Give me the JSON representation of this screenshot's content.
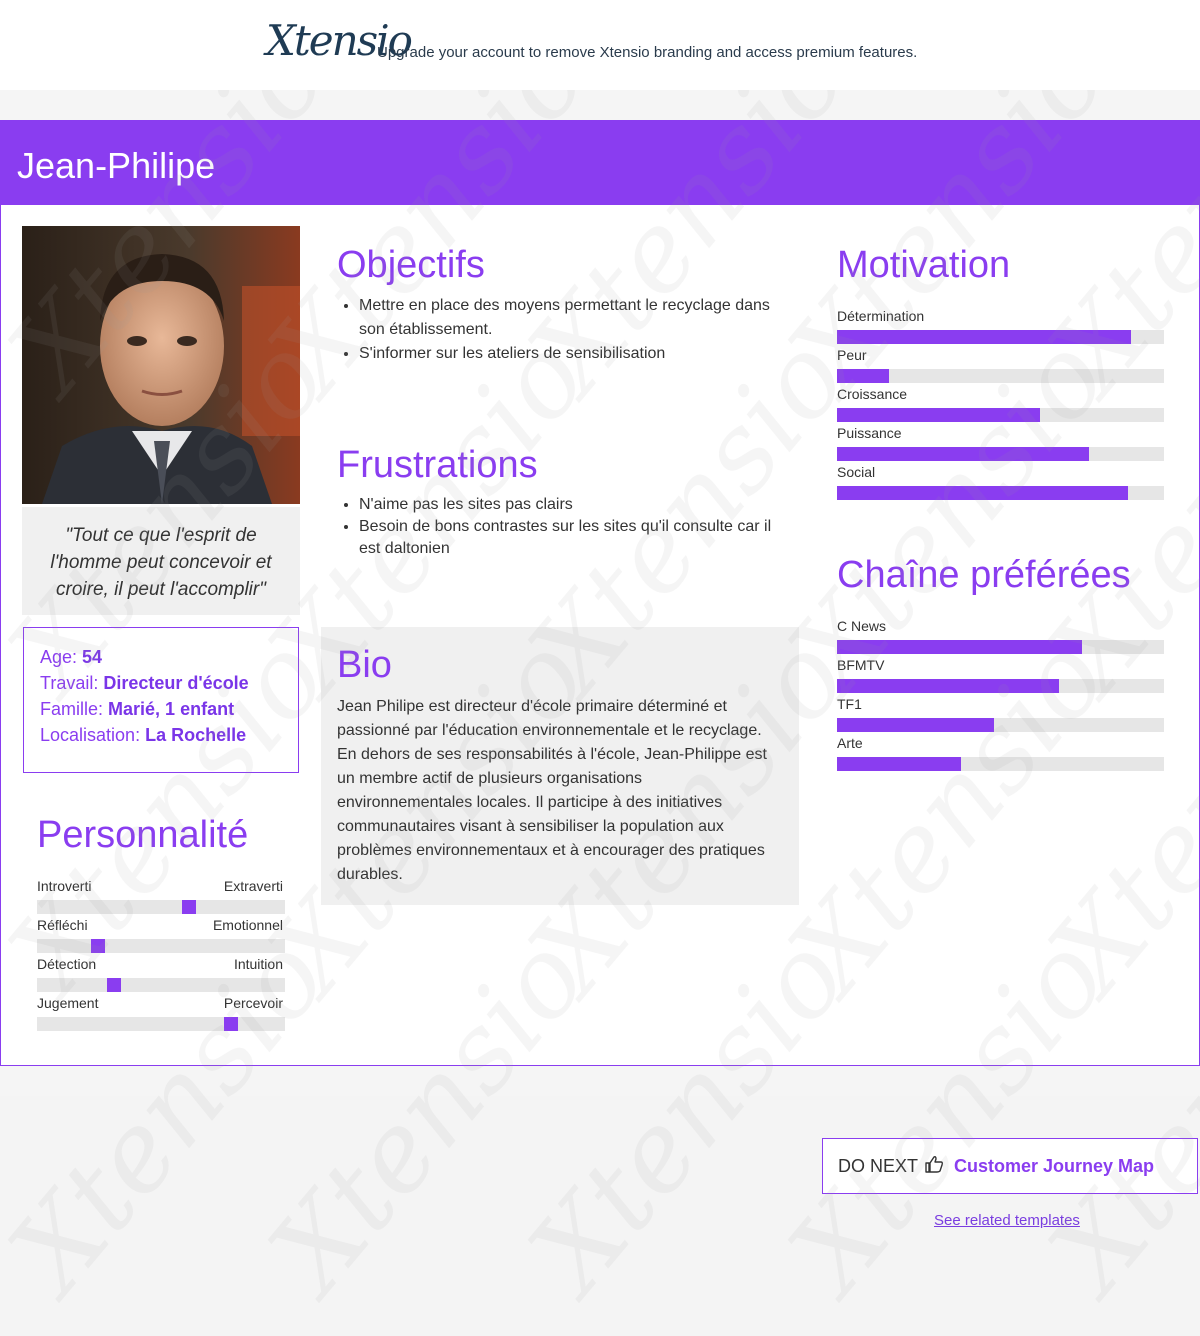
{
  "topbar": {
    "logo_text": "Xtensio",
    "upgrade_text": "Upgrade your account to remove Xtensio branding and access premium features."
  },
  "persona": {
    "name": "Jean-Philipe",
    "quote": "\"Tout ce que l'esprit de l'homme peut concevoir et croire, il peut l'accomplir\"",
    "facts": [
      {
        "label": "Age:",
        "value": "54"
      },
      {
        "label": "Travail:",
        "value": "Directeur d'école"
      },
      {
        "label": "Famille:",
        "value": "Marié, 1 enfant"
      },
      {
        "label": "Localisation:",
        "value": "La Rochelle"
      }
    ],
    "personality": {
      "title": "Personnalité",
      "sliders": [
        {
          "left": "Introverti",
          "right": "Extraverti",
          "level": 0.62
        },
        {
          "left": "Réfléchi",
          "right": "Emotionnel",
          "level": 0.23
        },
        {
          "left": "Détection",
          "right": "Intuition",
          "level": 0.3
        },
        {
          "left": "Jugement",
          "right": "Percevoir",
          "level": 0.8
        }
      ]
    },
    "objectives": {
      "title": "Objectifs",
      "items": [
        "Mettre en place des moyens permettant le recyclage dans son établissement.",
        "S'informer sur les ateliers de sensibilisation"
      ]
    },
    "frustrations": {
      "title": "Frustrations",
      "items": [
        "N'aime pas les sites pas clairs",
        "Besoin de bons contrastes sur les sites qu'il consulte car il est daltonien"
      ]
    },
    "bio": {
      "title": "Bio",
      "text": "Jean Philipe est directeur d'école primaire déterminé et passionné par l'éducation environnementale et le recyclage. En dehors de ses responsabilités à l'école, Jean-Philippe est un membre actif de plusieurs organisations environnementales locales. Il participe à des initiatives communautaires visant à sensibiliser la population aux problèmes environnementaux et à encourager des pratiques durables."
    },
    "motivation": {
      "title": "Motivation",
      "bars": [
        {
          "label": "Détermination",
          "level": 0.9
        },
        {
          "label": "Peur",
          "level": 0.16
        },
        {
          "label": "Croissance",
          "level": 0.62
        },
        {
          "label": "Puissance",
          "level": 0.77
        },
        {
          "label": "Social",
          "level": 0.89
        }
      ]
    },
    "channels": {
      "title": "Chaîne préférées",
      "bars": [
        {
          "label": "C News",
          "level": 0.75
        },
        {
          "label": "BFMTV",
          "level": 0.68
        },
        {
          "label": "TF1",
          "level": 0.48
        },
        {
          "label": "Arte",
          "level": 0.38
        }
      ]
    }
  },
  "footer": {
    "do_next_label": "DO NEXT",
    "do_next_link": "Customer Journey Map",
    "related_link": "See related templates"
  },
  "colors": {
    "accent": "#8a3df0",
    "track": "#e6e6e6",
    "panel": "#f0f0f0"
  }
}
